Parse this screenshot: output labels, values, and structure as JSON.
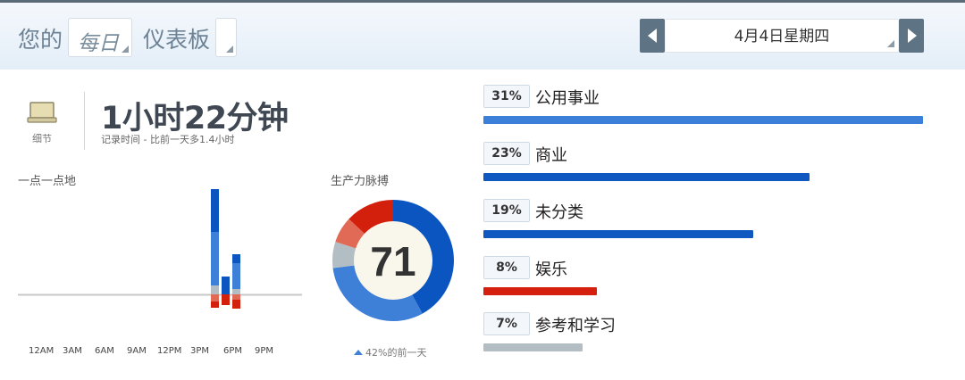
{
  "header": {
    "prefix": "您的",
    "period": "每日",
    "title": "仪表板",
    "date": "4月4日星期四"
  },
  "summary": {
    "details_label": "细节",
    "total_time": "1小时22分钟",
    "subtitle": "记录时间 - 比前一天多1.4小时"
  },
  "hourly": {
    "title": "一点一点地",
    "ticks": [
      "12AM",
      "3AM",
      "6AM",
      "9AM",
      "12PM",
      "3PM",
      "6PM",
      "9PM"
    ]
  },
  "pulse": {
    "title": "生产力脉搏",
    "score": "71",
    "trend": "42%的前一天"
  },
  "categories": [
    {
      "pct": "31%",
      "label": "公用事业",
      "value": 31,
      "color": "#3c7fd9"
    },
    {
      "pct": "23%",
      "label": "商业",
      "value": 23,
      "color": "#0f58c0"
    },
    {
      "pct": "19%",
      "label": "未分类",
      "value": 19,
      "color": "#0f58c0"
    },
    {
      "pct": "8%",
      "label": "娱乐",
      "value": 8,
      "color": "#d6200f"
    },
    {
      "pct": "7%",
      "label": "参考和学习",
      "value": 7,
      "color": "#b3bec4"
    }
  ],
  "colors": {
    "very_productive": "#0b55c1",
    "productive": "#3e7fd8",
    "neutral": "#b3bec4",
    "distracting": "#e06a55",
    "very_distracting": "#d3200d"
  },
  "chart_data": [
    {
      "type": "bar",
      "title": "一点一点地",
      "xlabel": "",
      "ylabel": "",
      "categories": [
        "12AM",
        "3AM",
        "6AM",
        "9AM",
        "12PM",
        "3PM",
        "6PM",
        "9PM"
      ],
      "series": [
        {
          "hour": 17,
          "very_productive": 48,
          "productive": 60,
          "neutral": 10,
          "distracting": 8,
          "very_distracting": 7
        },
        {
          "hour": 18,
          "very_productive": 20,
          "productive": 0,
          "neutral": 0,
          "distracting": 0,
          "very_distracting": 12
        },
        {
          "hour": 19,
          "very_productive": 10,
          "productive": 29,
          "neutral": 6,
          "distracting": 6,
          "very_distracting": 10
        }
      ]
    },
    {
      "type": "pie",
      "title": "生产力脉搏",
      "slices": [
        {
          "key": "very_productive",
          "value": 42
        },
        {
          "key": "productive",
          "value": 31
        },
        {
          "key": "neutral",
          "value": 7
        },
        {
          "key": "distracting",
          "value": 7
        },
        {
          "key": "very_distracting",
          "value": 13
        }
      ]
    }
  ]
}
